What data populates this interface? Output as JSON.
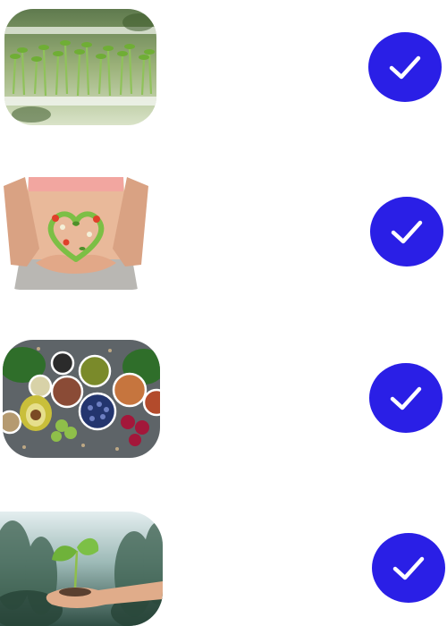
{
  "colors": {
    "check_fill": "#2a1fe6",
    "check_mark": "#ffffff",
    "background": "#ffffff"
  },
  "items": [
    {
      "thumbnail": "microgreens-sprouts-image",
      "icon": "checkmark-icon",
      "checked": true
    },
    {
      "thumbnail": "gut-health-heart-vegetables-image",
      "icon": "checkmark-icon",
      "checked": true
    },
    {
      "thumbnail": "superfoods-bowls-image",
      "icon": "checkmark-icon",
      "checked": true
    },
    {
      "thumbnail": "seedling-in-hand-image",
      "icon": "checkmark-icon",
      "checked": true
    }
  ]
}
